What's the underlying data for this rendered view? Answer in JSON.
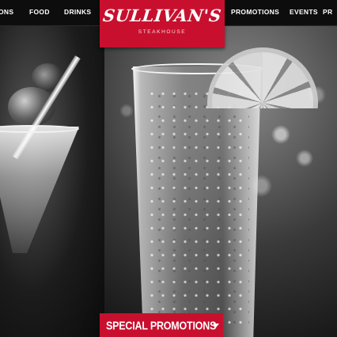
{
  "nav": {
    "items": [
      {
        "label": "ONS"
      },
      {
        "label": "FOOD"
      },
      {
        "label": "DRINKS"
      },
      {
        "label": "PROMOTIONS"
      },
      {
        "label": "EVENTS"
      },
      {
        "label": "PR"
      }
    ]
  },
  "logo": {
    "name": "SULLIVAN'S",
    "subtitle": "STEAKHOUSE"
  },
  "promo_tab": {
    "label": "SPECIAL PROMOTIONS"
  },
  "colors": {
    "brand_red": "#c8102e",
    "nav_background": "#0d0d0d",
    "nav_text": "#ffffff"
  },
  "icons": {
    "promo_caret": "chevron-down-icon"
  }
}
